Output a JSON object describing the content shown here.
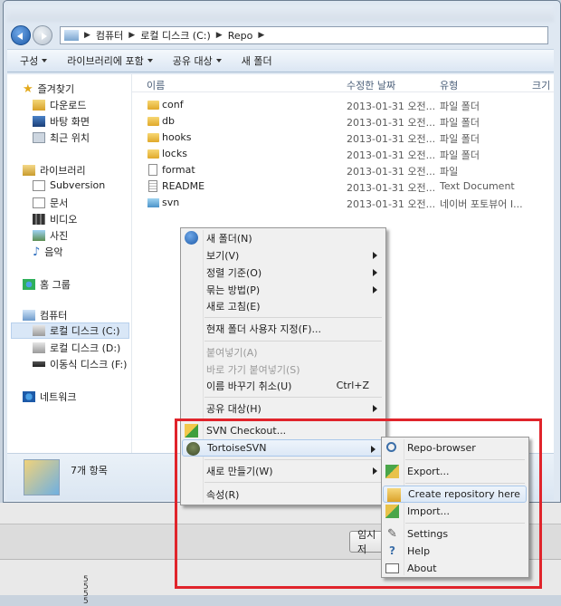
{
  "address": {
    "crumbs": [
      "컴퓨터",
      "로컬 디스크 (C:)",
      "Repo"
    ]
  },
  "toolbar": {
    "organize": "구성",
    "include_library": "라이브러리에 포함",
    "share_with": "공유 대상",
    "new_folder": "새 폴더"
  },
  "sidebar": {
    "favorites": "즐겨찾기",
    "downloads": "다운로드",
    "desktop": "바탕 화면",
    "recent": "최근 위치",
    "libraries": "라이브러리",
    "subversion": "Subversion",
    "documents": "문서",
    "videos": "비디오",
    "pictures": "사진",
    "music": "음악",
    "homegroup": "홈 그룹",
    "computer": "컴퓨터",
    "drive_c": "로컬 디스크 (C:)",
    "drive_d": "로컬 디스크 (D:)",
    "drive_f": "이동식 디스크 (F:)",
    "network": "네트워크"
  },
  "columns": {
    "name": "이름",
    "modified": "수정한 날짜",
    "type": "유형",
    "size": "크기"
  },
  "files": [
    {
      "name": "conf",
      "modified": "2013-01-31 오전...",
      "type": "파일 폴더"
    },
    {
      "name": "db",
      "modified": "2013-01-31 오전...",
      "type": "파일 폴더"
    },
    {
      "name": "hooks",
      "modified": "2013-01-31 오전...",
      "type": "파일 폴더"
    },
    {
      "name": "locks",
      "modified": "2013-01-31 오전...",
      "type": "파일 폴더"
    },
    {
      "name": "format",
      "modified": "2013-01-31 오전...",
      "type": "파일"
    },
    {
      "name": "README",
      "modified": "2013-01-31 오전...",
      "type": "Text Document"
    },
    {
      "name": "svn",
      "modified": "2013-01-31 오전...",
      "type": "네이버 포토뷰어 I..."
    }
  ],
  "details": {
    "count": "7개 항목"
  },
  "lower": {
    "temp_button": "임시저",
    "digits": [
      "5",
      "5",
      "5",
      "5"
    ]
  },
  "context_menu": {
    "new_folder": "새 폴더(N)",
    "view": "보기(V)",
    "sort_by": "정렬 기준(O)",
    "group_by": "묶는 방법(P)",
    "refresh": "새로 고침(E)",
    "customize": "현재 폴더 사용자 지정(F)...",
    "paste": "붙여넣기(A)",
    "paste_shortcut": "바로 가기 붙여넣기(S)",
    "undo_rename": "이름 바꾸기 취소(U)",
    "undo_shortcut": "Ctrl+Z",
    "share_with": "공유 대상(H)",
    "svn_checkout": "SVN Checkout...",
    "tortoisesvn": "TortoiseSVN",
    "new": "새로 만들기(W)",
    "properties": "속성(R)"
  },
  "submenu": {
    "repo_browser": "Repo-browser",
    "export": "Export...",
    "create_repo": "Create repository here",
    "import": "Import...",
    "settings": "Settings",
    "help": "Help",
    "about": "About"
  },
  "colors": {
    "highlight_box": "#e0242b",
    "menu_bg": "#f0f0f0",
    "selection": "#d9e7f7"
  }
}
